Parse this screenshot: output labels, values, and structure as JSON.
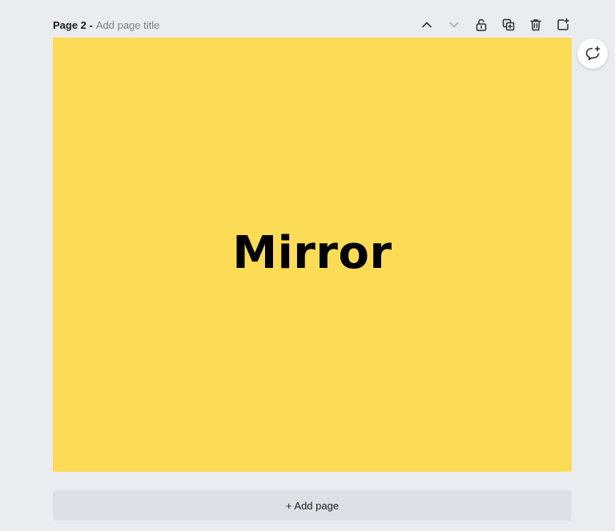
{
  "page_header": {
    "label": "Page 2 -",
    "title_placeholder": "Add page title"
  },
  "toolbar": {
    "buttons": [
      {
        "icon": "chevron-up-icon",
        "name": "move-page-up-button"
      },
      {
        "icon": "chevron-down-icon",
        "name": "move-page-down-button"
      },
      {
        "icon": "lock-icon",
        "name": "lock-page-button"
      },
      {
        "icon": "duplicate-icon",
        "name": "duplicate-page-button"
      },
      {
        "icon": "trash-icon",
        "name": "delete-page-button"
      },
      {
        "icon": "add-page-icon",
        "name": "add-page-after-button"
      }
    ]
  },
  "canvas": {
    "background_color": "#fcdc56",
    "text": "Mirror"
  },
  "comment": {
    "icon": "add-comment-icon"
  },
  "add_page": {
    "label": "+ Add page"
  }
}
